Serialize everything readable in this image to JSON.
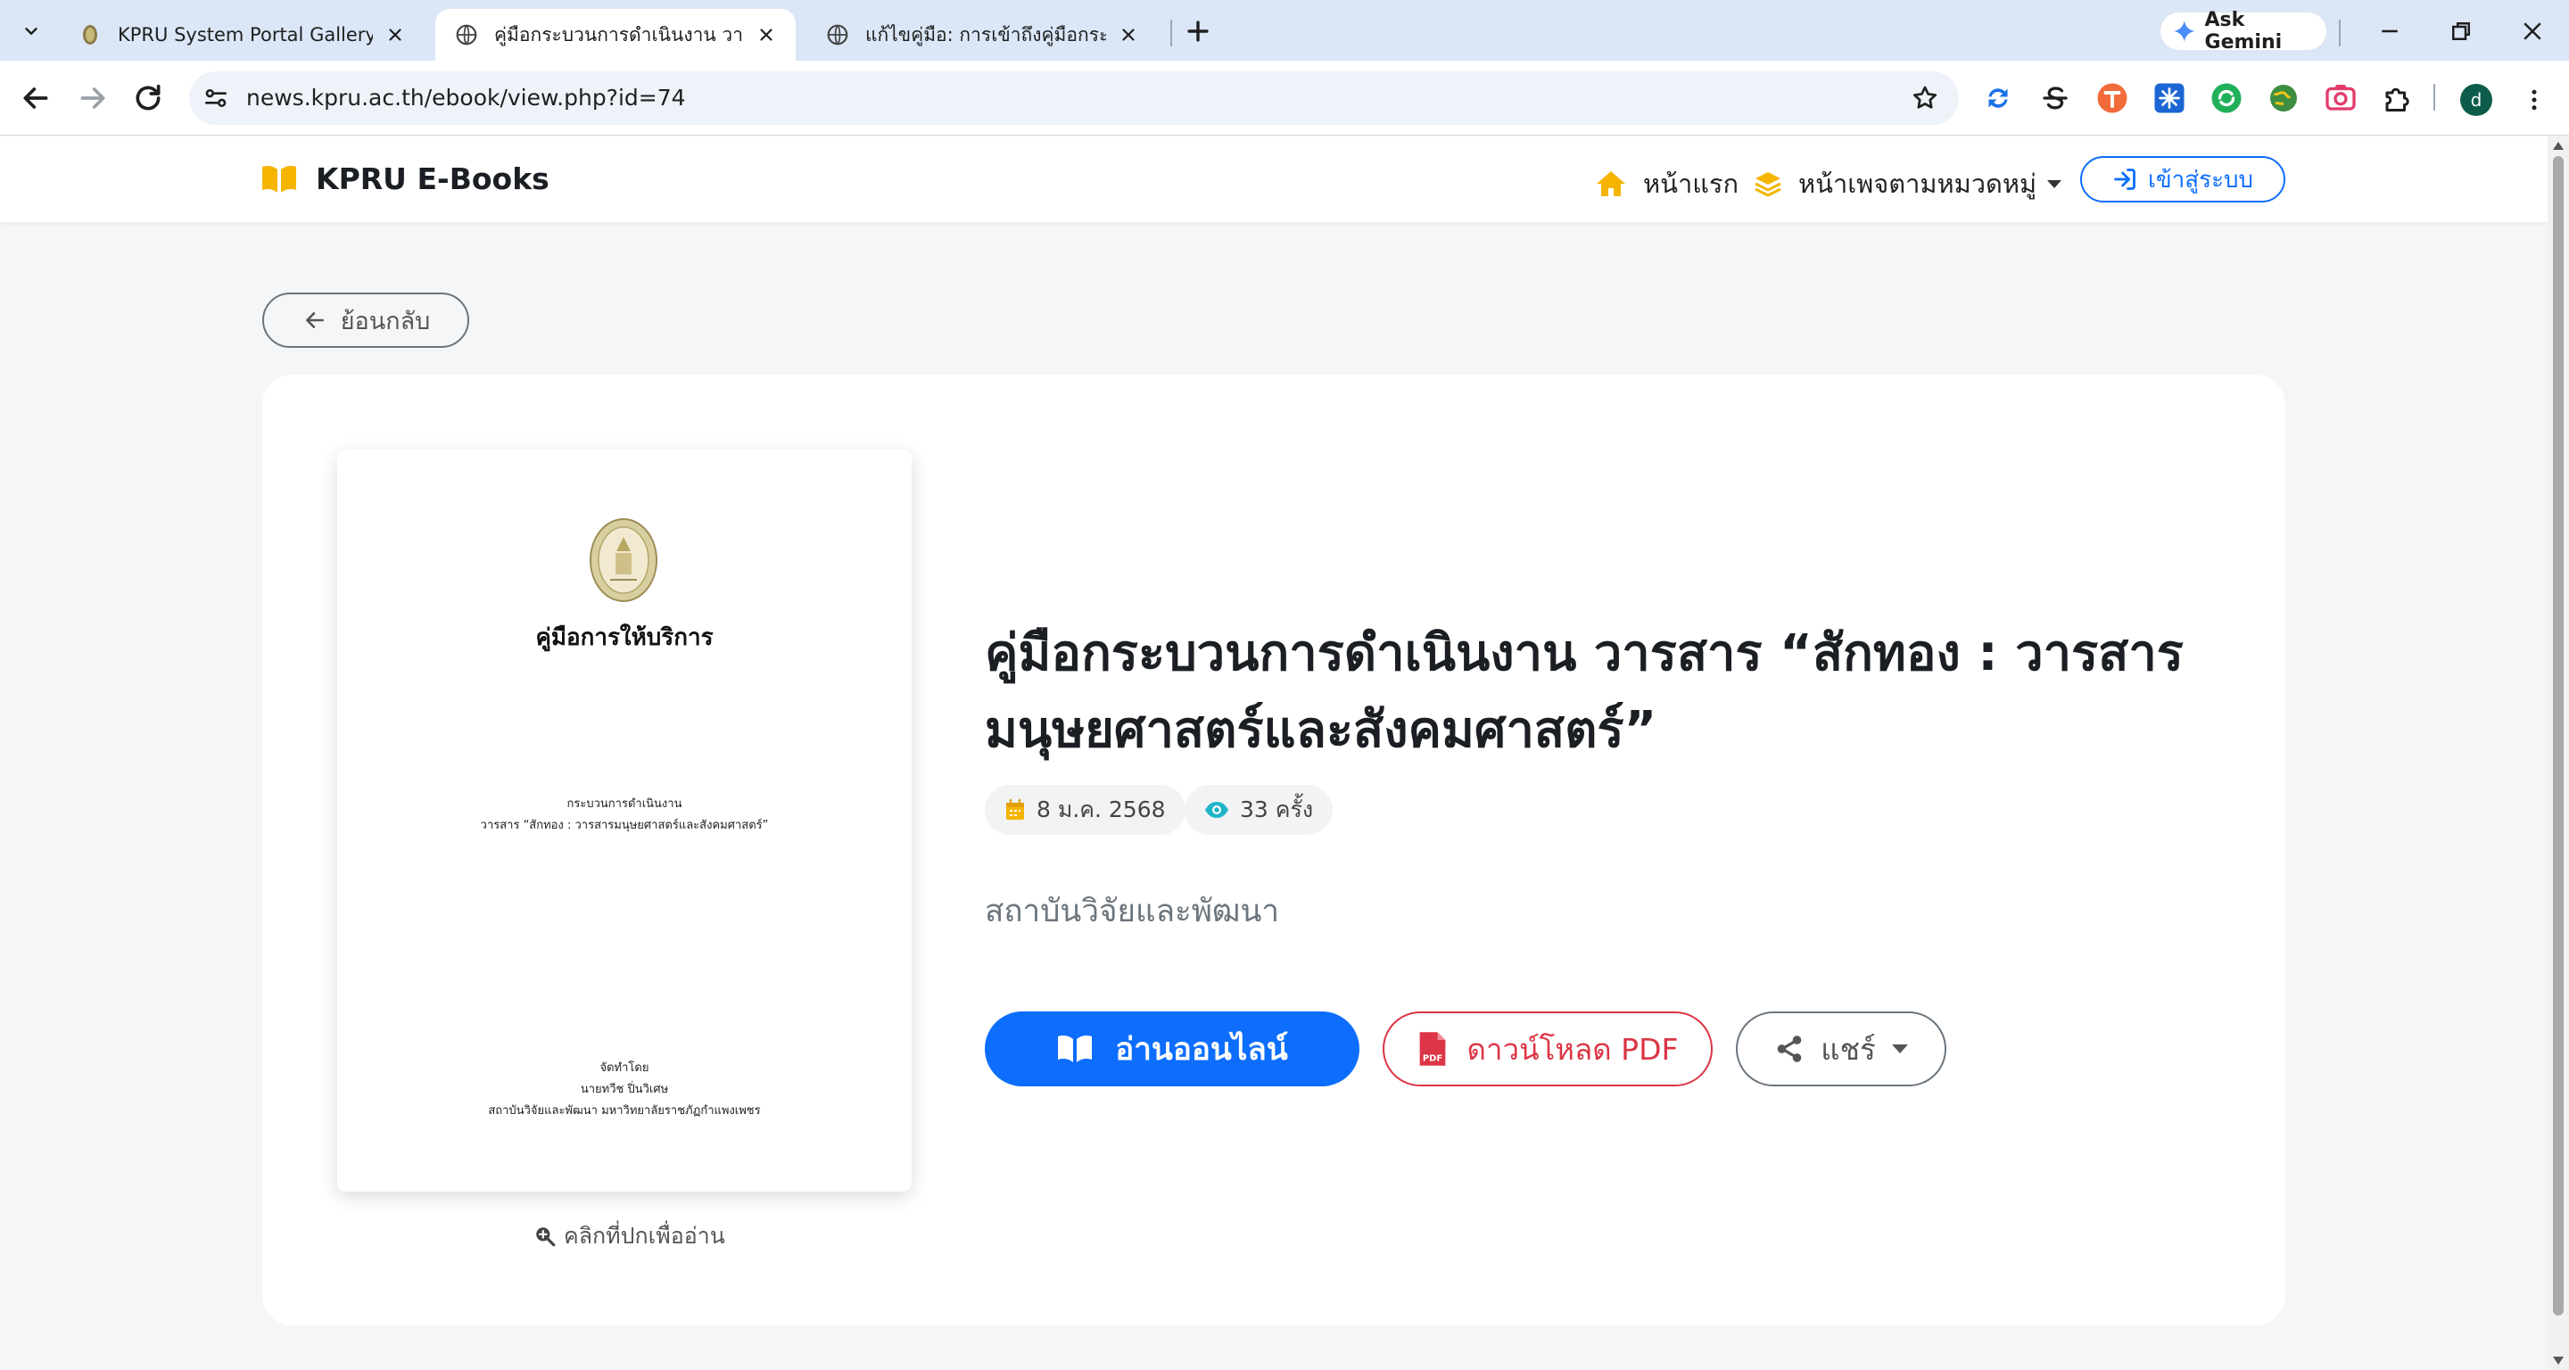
{
  "browser": {
    "tabs": [
      {
        "title": "KPRU System Portal Gallery",
        "active": false
      },
      {
        "title": "คู่มือกระบวนการดำเนินงาน วารสาร “สักทอง",
        "active": true
      },
      {
        "title": "แก้ไขคู่มือ: การเข้าถึงคู่มือกระบวนการ",
        "active": false
      }
    ],
    "gemini_label": "Ask Gemini",
    "url": "news.kpru.ac.th/ebook/view.php?id=74",
    "profile_initial": "d",
    "extensions": [
      "sync-icon",
      "s-extension-icon",
      "translate-icon",
      "snowflake-icon",
      "refresh-green-icon",
      "globe-extension-icon",
      "camera-extension-icon",
      "puzzle-icon"
    ]
  },
  "site": {
    "brand": "KPRU E-Books",
    "nav": {
      "home": "หน้าแรก",
      "categories": "หน้าเพจตามหมวดหมู่",
      "login": "เข้าสู่ระบบ"
    },
    "back_label": "ย้อนกลับ",
    "cover": {
      "title": "คู่มือการให้บริการ",
      "subtitle_line1": "กระบวนการดำเนินงาน",
      "subtitle_line2": "วารสาร “สักทอง : วารสารมนุษยศาสตร์และสังคมศาสตร์”",
      "by_label": "จัดทำโดย",
      "author": "นายทวีช ปิ่นวิเศษ",
      "organization": "สถาบันวิจัยและพัฒนา มหาวิทยาลัยราชภัฏกำแพงเพชร",
      "hint": "คลิกที่ปกเพื่ออ่าน"
    },
    "book": {
      "title": "คู่มือกระบวนการดำเนินงาน วารสาร “สักทอง : วารสารมนุษยศาสตร์และสังคมศาสตร์”",
      "date": "8 ม.ค. 2568",
      "views": "33 ครั้ง",
      "department": "สถาบันวิจัยและพัฒนา"
    },
    "actions": {
      "read": "อ่านออนไลน์",
      "download": "ดาวน์โหลด PDF",
      "share": "แชร์"
    },
    "colors": {
      "primary": "#0d6efd",
      "danger": "#dc3545",
      "accent": "#f5b400"
    }
  }
}
